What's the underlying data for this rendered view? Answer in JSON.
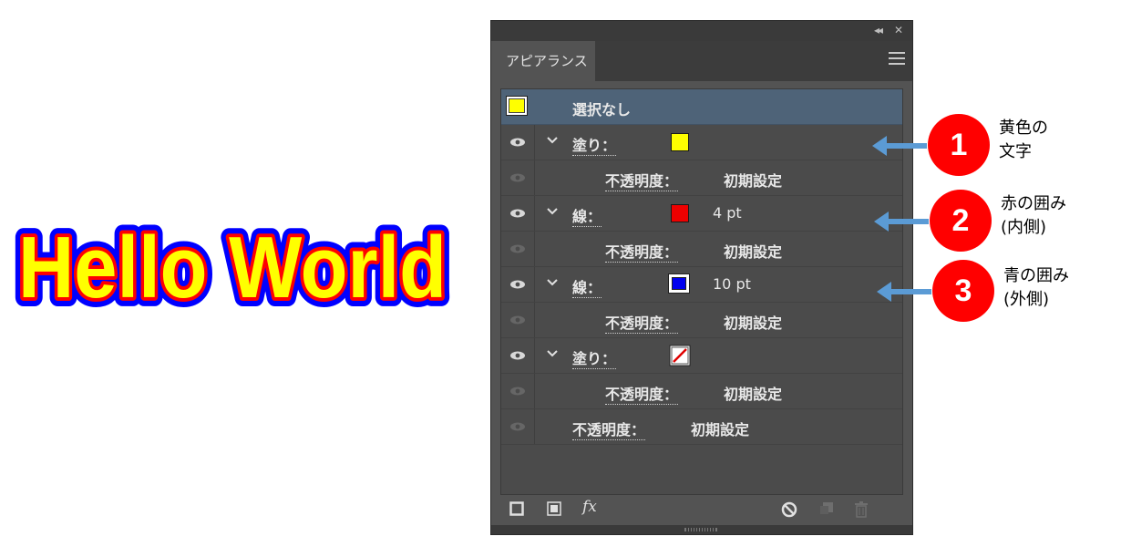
{
  "artwork": {
    "text": "Hello World",
    "fill_color": "#ffff00",
    "inner_stroke_color": "#ff0000",
    "outer_stroke_color": "#0000ff"
  },
  "panel": {
    "tab_label": "アピアランス",
    "header": {
      "label": "選択なし",
      "swatch_color": "#ffff00"
    },
    "rows": [
      {
        "type": "fill",
        "label": "塗り：",
        "swatch_color": "#ffff00"
      },
      {
        "type": "opacity",
        "label": "不透明度：",
        "value": "初期設定"
      },
      {
        "type": "stroke",
        "label": "線：",
        "swatch_color": "#ff0000",
        "value": "4 pt"
      },
      {
        "type": "opacity",
        "label": "不透明度：",
        "value": "初期設定"
      },
      {
        "type": "stroke",
        "label": "線：",
        "swatch_color": "#0000ff",
        "value": "10 pt"
      },
      {
        "type": "opacity",
        "label": "不透明度：",
        "value": "初期設定"
      },
      {
        "type": "fill",
        "label": "塗り：",
        "swatch_color": "none"
      },
      {
        "type": "opacity",
        "label": "不透明度：",
        "value": "初期設定"
      },
      {
        "type": "opacity",
        "label": "不透明度：",
        "value": "初期設定"
      }
    ],
    "bottom_icons": [
      "add-stroke-icon",
      "add-fill-icon",
      "fx-icon",
      "clear-appearance-icon",
      "duplicate-item-icon",
      "trash-icon"
    ],
    "fx_label": "fx"
  },
  "annotations": [
    {
      "number": "1",
      "line1": "黄色の",
      "line2": "文字"
    },
    {
      "number": "2",
      "line1": "赤の囲み",
      "line2": "(内側)"
    },
    {
      "number": "3",
      "line1": "青の囲み",
      "line2": "(外側)"
    }
  ]
}
